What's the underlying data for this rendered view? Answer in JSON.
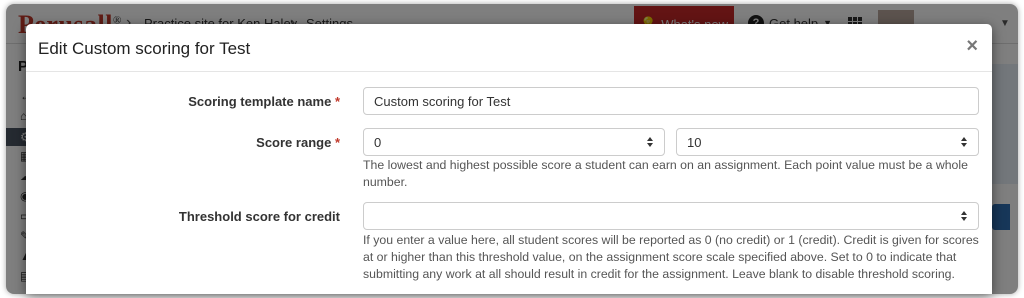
{
  "app": {
    "logo": "Perusall",
    "logo_mark": "®",
    "breadcrumb": [
      "Practice site for Ken Haley",
      "Settings"
    ],
    "whats_new": "What's new",
    "get_help": "Get help",
    "sidebar_title": "Pr"
  },
  "modal": {
    "title": "Edit Custom scoring for Test",
    "close": "×",
    "fields": {
      "template_name": {
        "label": "Scoring template name",
        "required": "*",
        "value": "Custom scoring for Test"
      },
      "score_range": {
        "label": "Score range",
        "required": "*",
        "min": "0",
        "max": "10",
        "help": "The lowest and highest possible score a student can earn on an assignment. Each point value must be a whole number."
      },
      "threshold": {
        "label": "Threshold score for credit",
        "value": "",
        "help": "If you enter a value here, all student scores will be reported as 0 (no credit) or 1 (credit). Credit is given for scores at or higher than this threshold value, on the assignment score scale specified above. Set to 0 to indicate that submitting any work at all should result in credit for the assignment. Leave blank to disable threshold scoring."
      }
    }
  },
  "colors": {
    "brand_red": "#c0392b",
    "whats_new_bg": "#c62828",
    "accent_blue": "#2f6fb3"
  }
}
